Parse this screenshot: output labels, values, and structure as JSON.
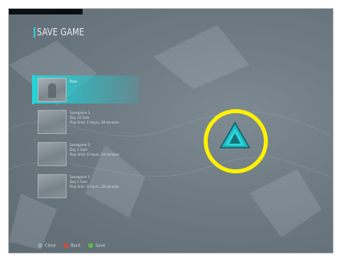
{
  "header": {
    "title": "SAVE GAME"
  },
  "slots": [
    {
      "title": "New",
      "line2": "",
      "line3": "",
      "selected": true
    },
    {
      "title": "Savegame 3",
      "line2": "Day 25 5am",
      "line3": "Play time: 1 hours, 18 minutes",
      "selected": false
    },
    {
      "title": "Savegame 2",
      "line2": "Day 1 5am",
      "line3": "Play time: 0 hours, 24 minutes",
      "selected": false
    },
    {
      "title": "Savegame 1",
      "line2": "Day 1 5am",
      "line3": "Play time: 0 hours, 18 minutes",
      "selected": false
    }
  ],
  "footer": {
    "close": "Close",
    "back": "Back",
    "save": "Save"
  },
  "colors": {
    "accent": "#24d6da",
    "ring": "#fff200",
    "background": "#6f7c84"
  },
  "icons": {
    "cursor": "triangle-cursor-icon",
    "close": "button-prompt-icon",
    "back": "b-button-icon",
    "save": "a-button-icon"
  }
}
